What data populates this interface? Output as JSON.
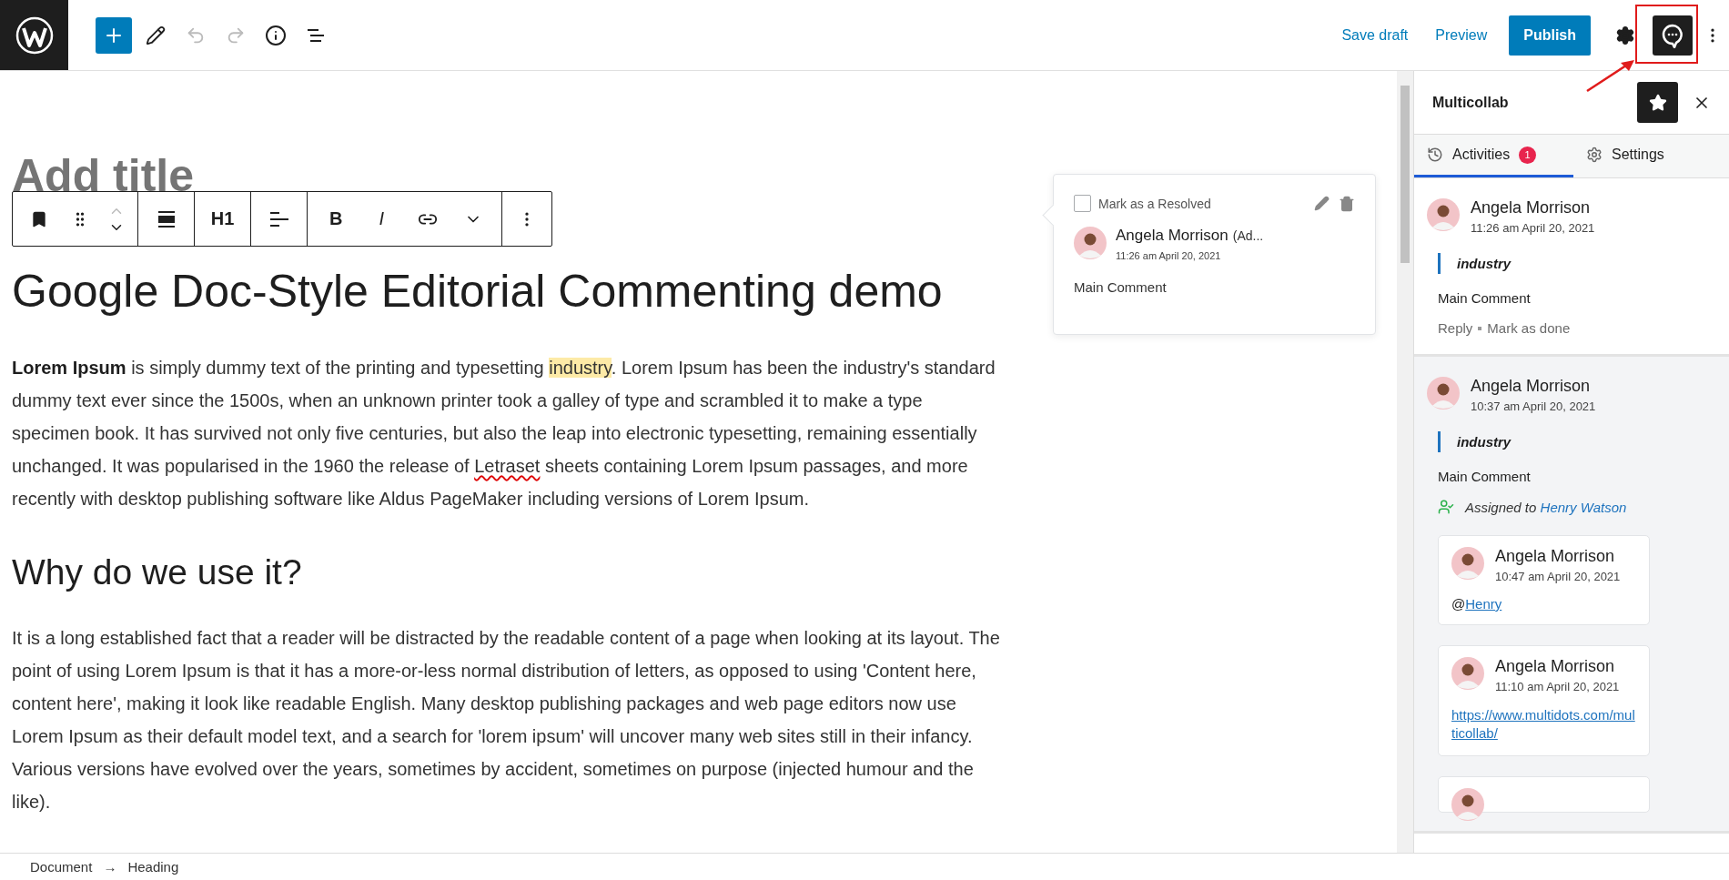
{
  "top_bar": {
    "save_draft": "Save draft",
    "preview": "Preview",
    "publish": "Publish"
  },
  "editor": {
    "title_placeholder": "Add title",
    "block_toolbar": {
      "heading_level": "H1",
      "bold": "B",
      "italic": "I"
    },
    "heading": "Google Doc-Style Editorial Commenting demo",
    "paragraph_1": [
      {
        "kind": "bold",
        "text": "Lorem Ipsum"
      },
      {
        "kind": "plain",
        "text": " is simply dummy text of the printing and typesetting "
      },
      {
        "kind": "highlight",
        "text": "industry"
      },
      {
        "kind": "plain",
        "text": ". Lorem Ipsum has been the industry's standard dummy text ever since the 1500s, when an unknown printer took a galley of type and scrambled it to make a type specimen book. It has survived not only five centuries, but also the leap into electronic typesetting, remaining essentially unchanged. It was popularised in the 1960 the release of "
      },
      {
        "kind": "misspelled",
        "text": "Letraset"
      },
      {
        "kind": "plain",
        "text": " sheets containing Lorem Ipsum passages, and more recently with desktop publishing software like Aldus PageMaker including versions of Lorem Ipsum."
      }
    ],
    "subheading": "Why do we use it?",
    "paragraph_2": "It is a long established fact that a reader will be distracted by the readable content of a page when looking at its layout. The point of using Lorem Ipsum is that it has a more-or-less normal distribution of letters, as opposed to using 'Content here, content here', making it look like readable English. Many desktop publishing packages and web page editors now use Lorem Ipsum as their default model text, and a search for 'lorem ipsum' will uncover many web sites still in their infancy. Various versions have evolved over the years, sometimes by accident, sometimes on purpose (injected humour and the like)."
  },
  "comment_popup": {
    "resolve_label": "Mark as a Resolved",
    "resolved": false,
    "author": "Angela Morrison",
    "role": "(Ad...",
    "time": "11:26 am April 20, 2021",
    "text": "Main Comment"
  },
  "sidebar": {
    "title": "Multicollab",
    "tabs": [
      {
        "label": "Activities",
        "badge": "1",
        "selected": true
      },
      {
        "label": "Settings",
        "selected": false
      }
    ],
    "threads": [
      {
        "selected": true,
        "author": "Angela Morrison",
        "time": "11:26 am April 20, 2021",
        "quote": "industry",
        "comment": "Main Comment",
        "actions": [
          "Reply",
          "Mark as done"
        ]
      },
      {
        "selected": false,
        "author": "Angela Morrison",
        "time": "10:37 am April 20, 2021",
        "quote": "industry",
        "comment": "Main Comment",
        "assignment": {
          "prefix": "Assigned to",
          "assignee": "Henry Watson"
        },
        "replies": [
          {
            "kind": "mention",
            "author": "Angela Morrison",
            "time": "10:47 am April 20, 2021",
            "prefix": "@",
            "text": "Henry"
          },
          {
            "kind": "link",
            "author": "Angela Morrison",
            "time": "11:10 am April 20, 2021",
            "text": "https://www.multidots.com/multicollab/"
          },
          {
            "kind": "cut"
          }
        ]
      }
    ]
  },
  "status_bar": {
    "breadcrumb": [
      "Document",
      "Heading"
    ],
    "separator": "→"
  }
}
